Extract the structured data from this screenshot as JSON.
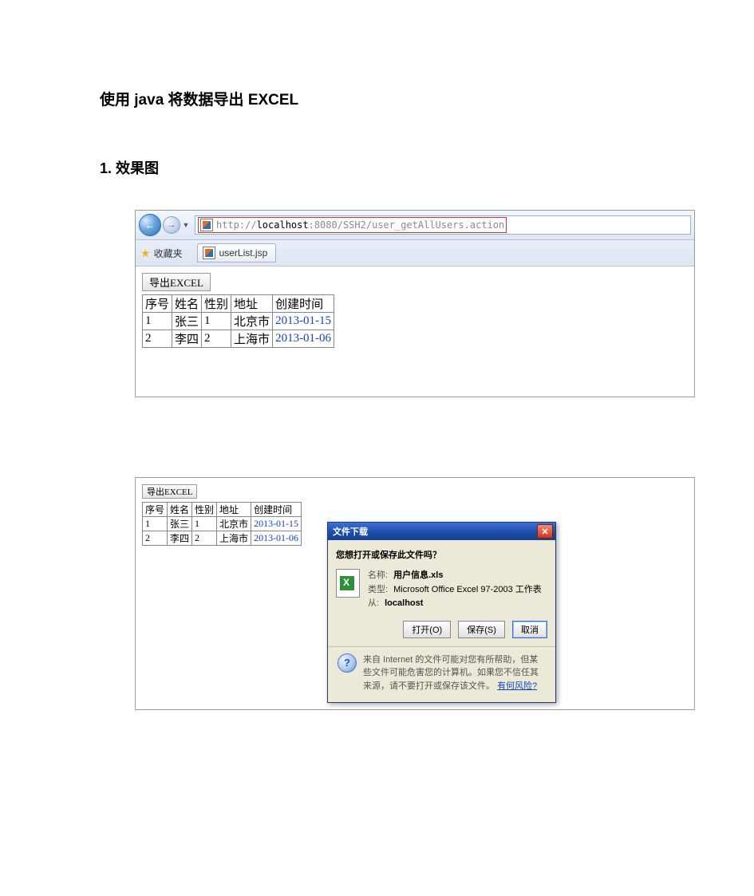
{
  "doc": {
    "title": "使用 java 将数据导出 EXCEL",
    "section1": "1. 效果图"
  },
  "browser": {
    "favorites_label": "收藏夹",
    "tab_label": "userList.jsp",
    "url_prefix": "http://",
    "url_host": "localhost",
    "url_rest": ":8080/SSH2/user_getAllUsers.action"
  },
  "table": {
    "export_btn": "导出EXCEL",
    "headers": [
      "序号",
      "姓名",
      "性别",
      "地址",
      "创建时间"
    ],
    "rows": [
      {
        "no": "1",
        "name": "张三",
        "sex": "1",
        "addr": "北京市",
        "date": "2013-01-15"
      },
      {
        "no": "2",
        "name": "李四",
        "sex": "2",
        "addr": "上海市",
        "date": "2013-01-06"
      }
    ]
  },
  "dialog": {
    "title": "文件下载",
    "question": "您想打开或保存此文件吗？",
    "meta": {
      "name_label": "名称:",
      "name_value": "用户信息.xls",
      "type_label": "类型:",
      "type_value": "Microsoft Office Excel 97-2003 工作表",
      "from_label": "从:",
      "from_value": "localhost"
    },
    "buttons": {
      "open": "打开(O)",
      "save": "保存(S)",
      "cancel": "取消"
    },
    "warning_text": "来自 Internet 的文件可能对您有所帮助，但某些文件可能危害您的计算机。如果您不信任其来源，请不要打开或保存该文件。",
    "warning_link": "有何风险?"
  }
}
